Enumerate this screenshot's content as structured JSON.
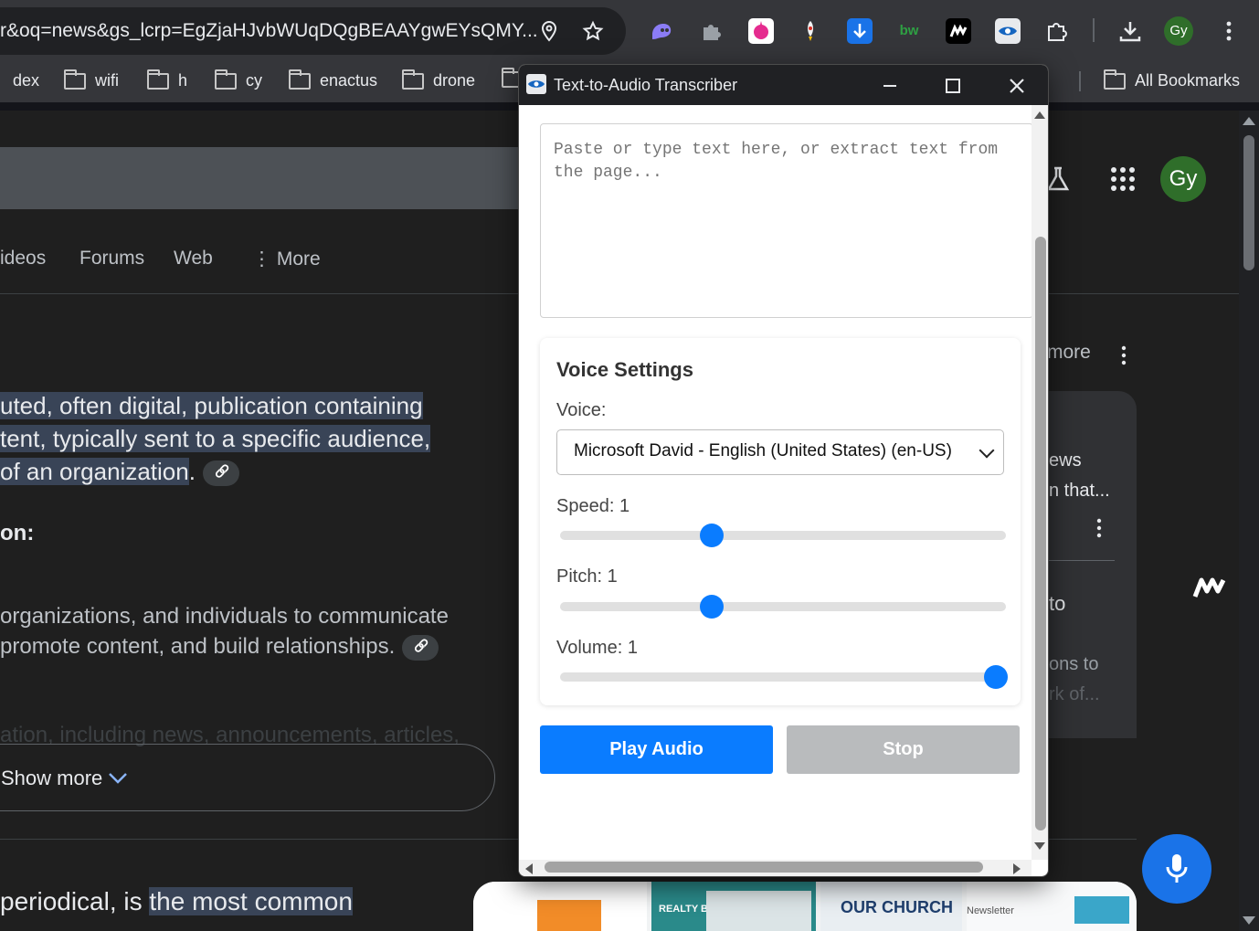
{
  "browser": {
    "omnibox_text": "r&oq=news&gs_lcrp=EgZjaHJvbWUqDQgBEAAYgwEYsQMY...",
    "profile_initials": "Gy",
    "bookmarks": [
      "dex",
      "wifi",
      "h",
      "cy",
      "enactus",
      "drone"
    ],
    "all_bookmarks_label": "All Bookmarks",
    "extension_label_bw": "bw"
  },
  "page": {
    "tabs": [
      "ideos",
      "Forums",
      "Web",
      "More"
    ],
    "ai_lines": [
      "uted, often digital, publication containing",
      "tent, typically sent to a specific audience,",
      " of an organization"
    ],
    "section_heading": "on:",
    "body_lines": [
      "organizations, and individuals to communicate",
      "promote content, and build relationships."
    ],
    "faded_line": "ation, including news, announcements, articles,",
    "show_more_label": "Show more",
    "bottom_text_plain": "periodical, is ",
    "bottom_text_highlight": "the most common",
    "right_panel": {
      "more_label": "more",
      "line1": "ews",
      "line2": "n that...",
      "line3": "to",
      "line4": "ons to",
      "line5": "rk of..."
    },
    "profile_initials": "Gy",
    "thumbnails": [
      "REALTY BUZZ",
      "OUR CHURCH",
      "Newsletter"
    ]
  },
  "popup": {
    "title": "Text-to-Audio Transcriber",
    "textarea_placeholder": "Paste or type text here, or extract text from the page...",
    "settings_title": "Voice Settings",
    "voice_label": "Voice:",
    "voice_selected": "Microsoft David - English (United States) (en-US)",
    "speed_label": "Speed: 1",
    "pitch_label": "Pitch: 1",
    "volume_label": "Volume: 1",
    "speed_value": 1,
    "pitch_value": 1,
    "volume_value": 1,
    "play_label": "Play Audio",
    "stop_label": "Stop",
    "colors": {
      "accent": "#0a7cff",
      "stop": "#b9bbbd"
    }
  }
}
